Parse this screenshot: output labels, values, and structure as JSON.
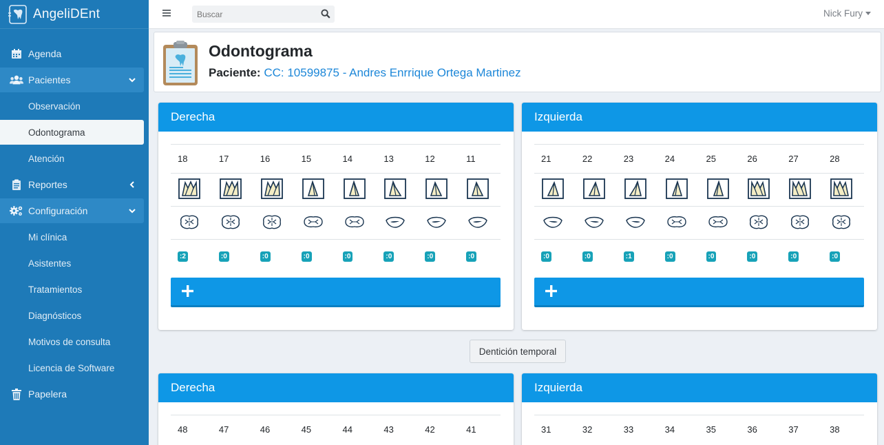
{
  "app": {
    "name": "AngeliDEnt"
  },
  "sidebar": {
    "items": [
      {
        "label": "Agenda",
        "icon": "calendar-icon"
      },
      {
        "label": "Pacientes",
        "icon": "users-icon"
      },
      {
        "label": "Observación"
      },
      {
        "label": "Odontograma",
        "active": true
      },
      {
        "label": "Atención"
      },
      {
        "label": "Reportes",
        "icon": "clipboard-icon"
      },
      {
        "label": "Configuración",
        "icon": "gears-icon"
      },
      {
        "label": "Mi clínica"
      },
      {
        "label": "Asistentes"
      },
      {
        "label": "Tratamientos"
      },
      {
        "label": "Diagnósticos"
      },
      {
        "label": "Motivos de consulta"
      },
      {
        "label": "Licencia de Software"
      },
      {
        "label": "Papelera",
        "icon": "trash-icon"
      }
    ]
  },
  "topbar": {
    "search_placeholder": "Buscar",
    "user": "Nick Fury"
  },
  "header": {
    "title": "Odontograma",
    "patient_label": "Paciente:",
    "patient_link": "CC: 10599875 - Andres Enrrique Ortega Martinez"
  },
  "panels": {
    "upper_right": {
      "title": "Derecha",
      "teeth": [
        {
          "n": "18",
          "badge": ":2",
          "type": "molar"
        },
        {
          "n": "17",
          "badge": ":0",
          "type": "molar"
        },
        {
          "n": "16",
          "badge": ":0",
          "type": "molar"
        },
        {
          "n": "15",
          "badge": ":0",
          "type": "premolar"
        },
        {
          "n": "14",
          "badge": ":0",
          "type": "premolar"
        },
        {
          "n": "13",
          "badge": ":0",
          "type": "canine"
        },
        {
          "n": "12",
          "badge": ":0",
          "type": "incisor"
        },
        {
          "n": "11",
          "badge": ":0",
          "type": "incisor"
        }
      ]
    },
    "upper_left": {
      "title": "Izquierda",
      "teeth": [
        {
          "n": "21",
          "badge": ":0",
          "type": "incisor"
        },
        {
          "n": "22",
          "badge": ":0",
          "type": "incisor"
        },
        {
          "n": "23",
          "badge": ":1",
          "type": "canine"
        },
        {
          "n": "24",
          "badge": ":0",
          "type": "premolar"
        },
        {
          "n": "25",
          "badge": ":0",
          "type": "premolar"
        },
        {
          "n": "26",
          "badge": ":0",
          "type": "molar"
        },
        {
          "n": "27",
          "badge": ":0",
          "type": "molar"
        },
        {
          "n": "28",
          "badge": ":0",
          "type": "molar"
        }
      ]
    },
    "lower_right": {
      "title": "Derecha",
      "teeth": [
        {
          "n": "48"
        },
        {
          "n": "47"
        },
        {
          "n": "46"
        },
        {
          "n": "45"
        },
        {
          "n": "44"
        },
        {
          "n": "43"
        },
        {
          "n": "42"
        },
        {
          "n": "41"
        }
      ]
    },
    "lower_left": {
      "title": "Izquierda",
      "teeth": [
        {
          "n": "31"
        },
        {
          "n": "32"
        },
        {
          "n": "33"
        },
        {
          "n": "34"
        },
        {
          "n": "35"
        },
        {
          "n": "36"
        },
        {
          "n": "37"
        },
        {
          "n": "38"
        }
      ]
    }
  },
  "add_button_label": "+",
  "temporal_button": "Dentición temporal",
  "colors": {
    "sidebar": "#1e7ab8",
    "panel_header": "#0e97e6",
    "badge": "#17a2b8",
    "link": "#1d87d8",
    "tooth_outline": "#1a3550",
    "tooth_fill": "#f3ecc4"
  }
}
